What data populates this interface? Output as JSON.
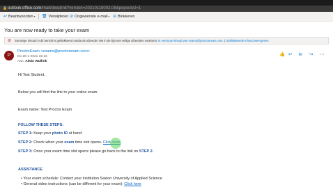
{
  "browser": {
    "url_host": "outlook.office.com",
    "url_path": "/mail/deeplink?version=20210118002.08&popoutv2=1"
  },
  "toolbar": {
    "reply_label": "Beantwoorden",
    "delete_label": "Verwijderen",
    "junk_label": "Ongewenste e-mail",
    "block_label": "Blokkeren"
  },
  "message": {
    "subject": "You are now ready to take your exam",
    "warning": "Sommige inhoud in dit bericht is geblokkeerd omdat de afzender niet in de lijst met veilige afzenders voorkomt.",
    "trust_link": "Ik vertrouw inhoud van exams@proctorexam.com.",
    "show_blocked_link": "Geblokkeerde inhoud weergeven",
    "avatar_initial": "P",
    "sender": "ProctorExam <exams@proctorexam.com>",
    "date": "Do 28-1-2021 15:16",
    "to_label": "Aan:",
    "to_name": "Alwin Wullink"
  },
  "email_body": {
    "greeting": "Hi Test Student,",
    "intro": "Below you will find the link to your online exam.",
    "exam_name": "Exam name: Test Proctor Exam",
    "follow_heading": "FOLLOW THESE STEPS:",
    "step1_label": "STEP 1:",
    "step1_text_a": "Keep your ",
    "step1_bold": "photo ID",
    "step1_text_b": " at hand.",
    "step2_label": "STEP 2:",
    "step2_text_a": "Check when your ",
    "step2_bold": "exam",
    "step2_text_b": " time slot opens. ",
    "step2_link": "Click here",
    "step3_label": "STEP 3:",
    "step3_text_a": "Once your exam time slot opens please go back to the link on ",
    "step3_bold": "STEP 2.",
    "assistance_heading": "ASSISTANCE",
    "assist1": "Your exam schedule: Contact your institution Saxion University of Applied Science",
    "assist2_text": "General video instructions (can be different for your exam): ",
    "assist2_link": "Click here"
  },
  "colors": {
    "accent": "#0078d4",
    "heading_blue": "#1b4f9b",
    "avatar_bg": "#8a1313"
  }
}
